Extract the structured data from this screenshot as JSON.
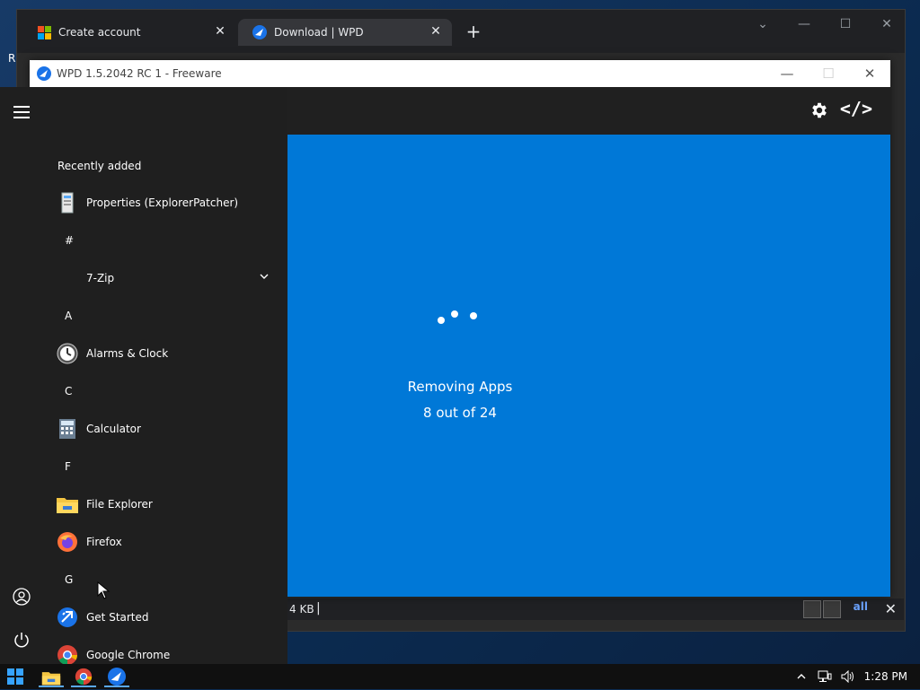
{
  "desktop": {
    "left_fragment": "R"
  },
  "browser": {
    "tabs": [
      {
        "label": "Create account",
        "icon": "microsoft-logo-icon"
      },
      {
        "label": "Download | WPD",
        "icon": "wpd-logo-icon"
      }
    ],
    "status_fragment": "4 KB",
    "right_fragment": "all"
  },
  "wpd": {
    "title": "WPD 1.5.2042 RC 1 - Freeware",
    "status_line1": "Removing Apps",
    "status_line2": "8 out of 24",
    "colors": {
      "main_bg": "#0078d7",
      "titlebar_bg": "#202020"
    }
  },
  "start": {
    "recently_added_label": "Recently added",
    "items": [
      {
        "type": "app",
        "label": "Properties (ExplorerPatcher)",
        "icon": "properties-icon"
      },
      {
        "type": "letter",
        "label": "#"
      },
      {
        "type": "folder",
        "label": "7-Zip",
        "icon": "chevron-down-icon"
      },
      {
        "type": "letter",
        "label": "A"
      },
      {
        "type": "app",
        "label": "Alarms & Clock",
        "icon": "alarms-clock-icon"
      },
      {
        "type": "letter",
        "label": "C"
      },
      {
        "type": "app",
        "label": "Calculator",
        "icon": "calculator-icon"
      },
      {
        "type": "letter",
        "label": "F"
      },
      {
        "type": "app",
        "label": "File Explorer",
        "icon": "file-explorer-icon"
      },
      {
        "type": "app",
        "label": "Firefox",
        "icon": "firefox-icon"
      },
      {
        "type": "letter",
        "label": "G"
      },
      {
        "type": "app",
        "label": "Get Started",
        "icon": "get-started-icon"
      },
      {
        "type": "app",
        "label": "Google Chrome",
        "icon": "chrome-icon"
      }
    ]
  },
  "taskbar": {
    "time": "1:28 PM"
  }
}
